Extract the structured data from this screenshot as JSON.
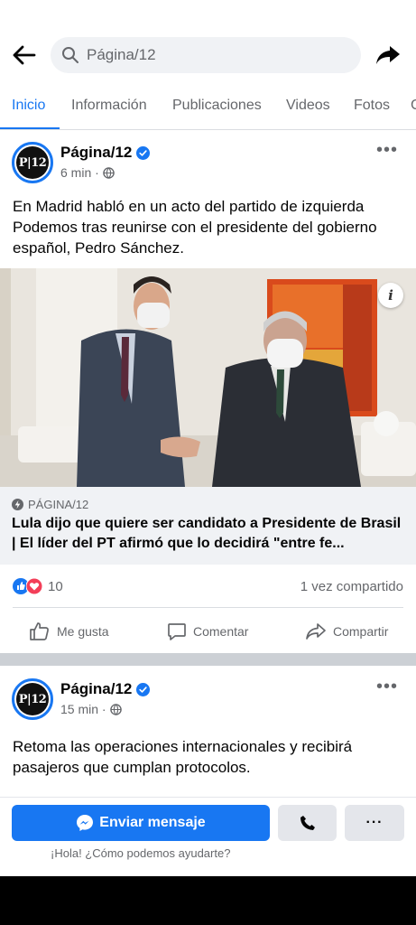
{
  "header": {
    "search_text": "Página/12"
  },
  "tabs": [
    {
      "label": "Inicio"
    },
    {
      "label": "Información"
    },
    {
      "label": "Publicaciones"
    },
    {
      "label": "Videos"
    },
    {
      "label": "Fotos"
    }
  ],
  "posts": [
    {
      "page_name": "Página/12",
      "avatar_text": "P|12",
      "time": "6 min",
      "text": "En Madrid habló en un acto del partido de izquierda Podemos tras reunirse con el presidente del gobierno español, Pedro Sánchez.",
      "link_source": "PÁGINA/12",
      "link_title": "Lula dijo que quiere ser candidato a Presidente de Brasil | El líder del PT afirmó que lo decidirá \"entre fe...",
      "reaction_count": "10",
      "shares": "1 vez compartido",
      "actions": {
        "like": "Me gusta",
        "comment": "Comentar",
        "share": "Compartir"
      }
    },
    {
      "page_name": "Página/12",
      "avatar_text": "P|12",
      "time": "15 min",
      "text": "Retoma las operaciones internacionales y recibirá pasajeros que cumplan protocolos."
    }
  ],
  "bottom": {
    "send_label": "Enviar mensaje",
    "more_label": "···",
    "hint": "¡Hola! ¿Cómo podemos ayudarte?"
  },
  "colors": {
    "accent": "#1877f2",
    "like_blue": "#1877f2",
    "love_red": "#f33e58"
  },
  "icons": [
    "back-arrow-icon",
    "search-icon",
    "share-arrow-icon",
    "verified-badge-icon",
    "globe-icon",
    "more-dots-icon",
    "info-icon",
    "bolt-icon",
    "like-reaction-icon",
    "love-reaction-icon",
    "thumbs-up-icon",
    "comment-icon",
    "share-icon",
    "messenger-icon",
    "phone-icon"
  ]
}
